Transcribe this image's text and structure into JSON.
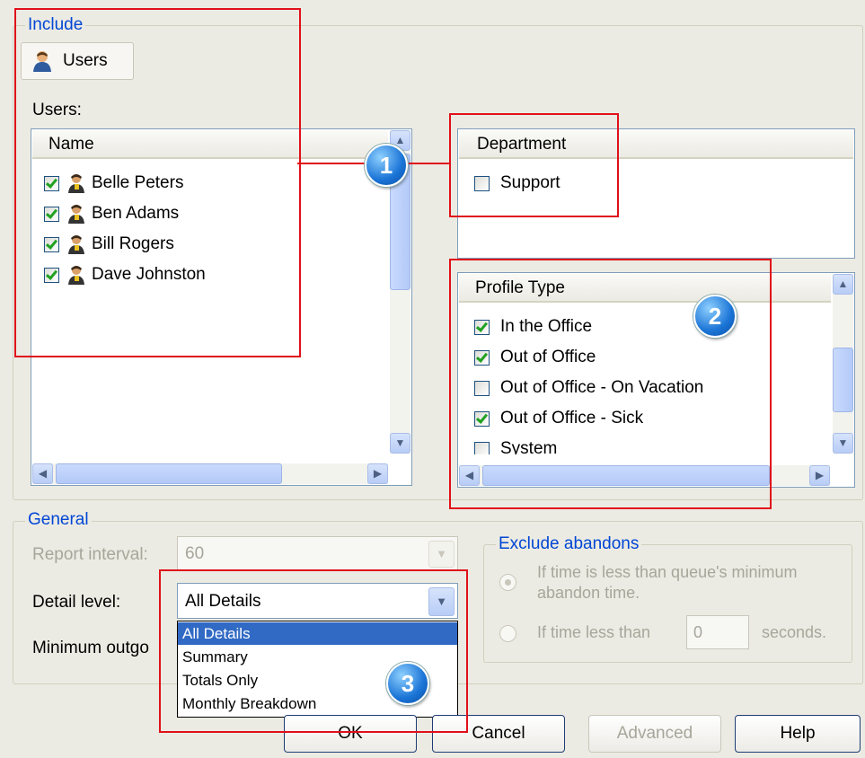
{
  "include": {
    "legend": "Include",
    "tab_label": "Users",
    "users_label": "Users:",
    "users_list": {
      "header": "Name",
      "items": [
        {
          "label": "Belle Peters",
          "checked": true
        },
        {
          "label": "Ben Adams",
          "checked": true
        },
        {
          "label": "Bill Rogers",
          "checked": true
        },
        {
          "label": "Dave Johnston",
          "checked": true
        }
      ]
    },
    "department_list": {
      "header": "Department",
      "items": [
        {
          "label": "Support",
          "checked": false
        }
      ]
    },
    "profile_list": {
      "header": "Profile Type",
      "items": [
        {
          "label": "In the Office",
          "checked": true
        },
        {
          "label": "Out of Office",
          "checked": true
        },
        {
          "label": "Out of Office - On Vacation",
          "checked": false
        },
        {
          "label": "Out of Office - Sick",
          "checked": true
        },
        {
          "label": "System",
          "checked": false
        }
      ]
    }
  },
  "general": {
    "legend": "General",
    "report_interval_label": "Report interval:",
    "report_interval_value": "60",
    "detail_level_label": "Detail level:",
    "detail_level_value": "All Details",
    "minimum_outgoing_label": "Minimum outgo",
    "detail_options": [
      "All Details",
      "Summary",
      "Totals Only",
      "Monthly Breakdown"
    ],
    "selected_option": "All Details"
  },
  "exclude_abandons": {
    "legend": "Exclude abandons",
    "option1_line1": "If time is less than queue's minimum",
    "option1_line2": "abandon time.",
    "option2_prefix": "If time less than",
    "option2_value": "0",
    "option2_suffix": "seconds."
  },
  "buttons": {
    "ok": "OK",
    "cancel": "Cancel",
    "advanced": "Advanced",
    "help": "Help"
  },
  "callouts": [
    "1",
    "2",
    "3"
  ],
  "colors": {
    "highlight_red": "#e0101a",
    "selection_blue": "#316ac5",
    "legend_blue": "#0046d5"
  }
}
